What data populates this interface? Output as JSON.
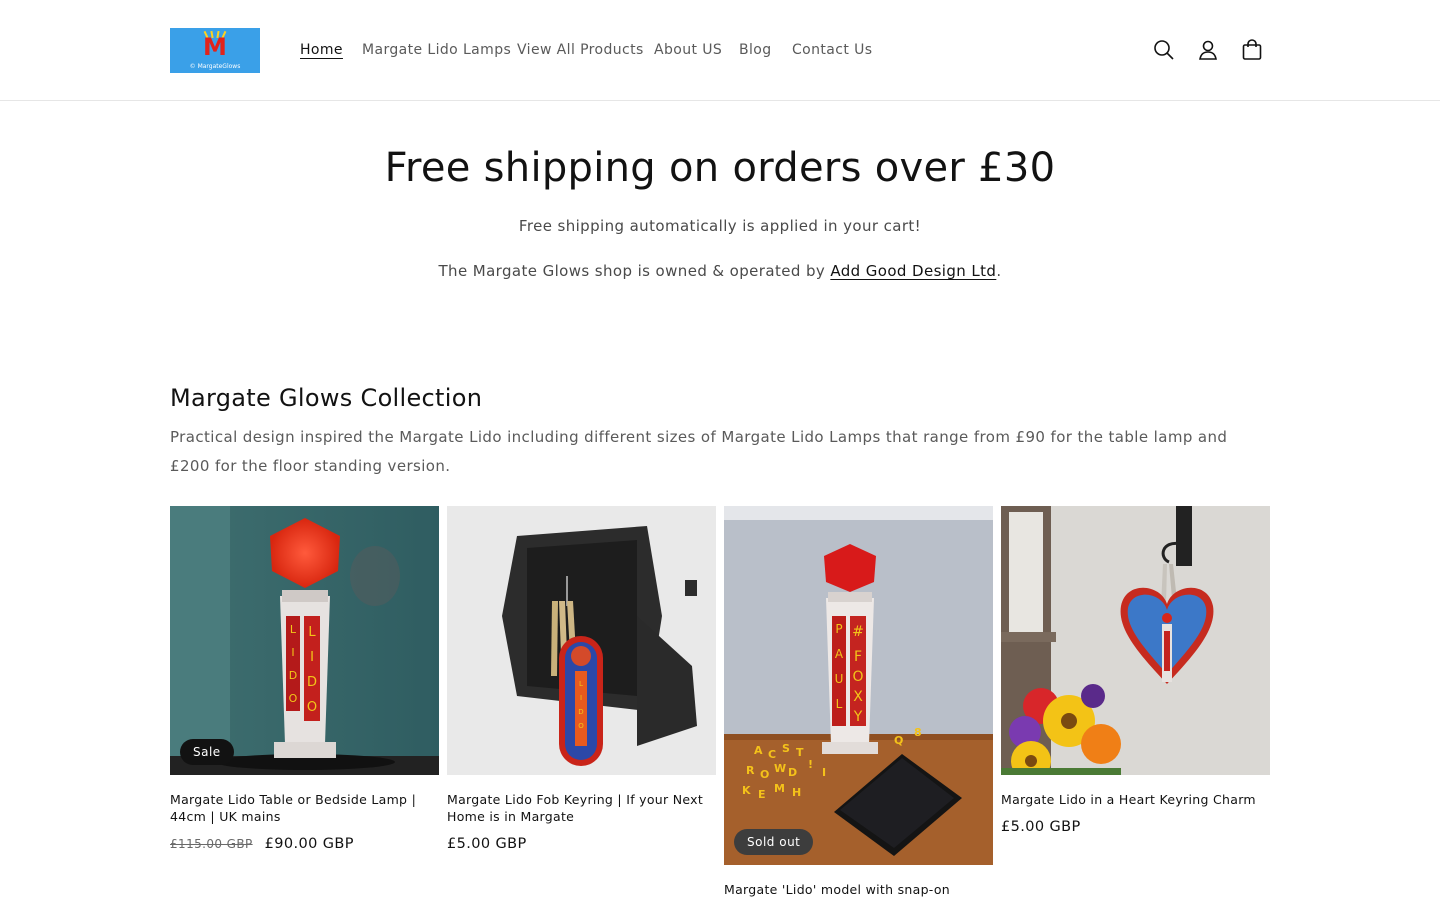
{
  "header": {
    "logo_text": "M",
    "logo_subtext": "© MargateGlows",
    "nav": [
      {
        "label": "Home",
        "active": true
      },
      {
        "label": "Margate Lido Lamps",
        "active": false
      },
      {
        "label": "View All Products",
        "active": false
      },
      {
        "label": "About US",
        "active": false
      },
      {
        "label": "Blog",
        "active": false
      },
      {
        "label": "Contact Us",
        "active": false
      }
    ],
    "icons": [
      "search-icon",
      "account-icon",
      "cart-icon"
    ]
  },
  "banner": {
    "title": "Free shipping on orders over £30",
    "line1": "Free shipping automatically is applied in your cart!",
    "line2_prefix": "The Margate Glows shop is owned & operated by ",
    "line2_link": "Add Good Design Ltd",
    "line2_suffix": "."
  },
  "collection": {
    "title": "Margate Glows Collection",
    "description": "Practical design inspired the Margate Lido including different sizes of Margate Lido Lamps that range from £90 for the table lamp and £200 for the floor standing version.",
    "products": [
      {
        "title": "Margate Lido Table or Bedside Lamp | 44cm | UK mains",
        "price_old": "£115.00 GBP",
        "price": "£90.00 GBP",
        "badge": "Sale"
      },
      {
        "title": "Margate Lido Fob Keyring | If your Next Home is in Margate",
        "price": "£5.00 GBP"
      },
      {
        "title": "Margate 'Lido' model with snap-on letters",
        "badge": "Sold out"
      },
      {
        "title": "Margate Lido in a Heart Keyring Charm",
        "price": "£5.00 GBP"
      }
    ]
  },
  "colors": {
    "text": "#121212",
    "muted": "#5a5a5a",
    "badge_bg": "#121212",
    "logo_bg": "#3aa0e8",
    "lido_red": "#d62b1f"
  }
}
